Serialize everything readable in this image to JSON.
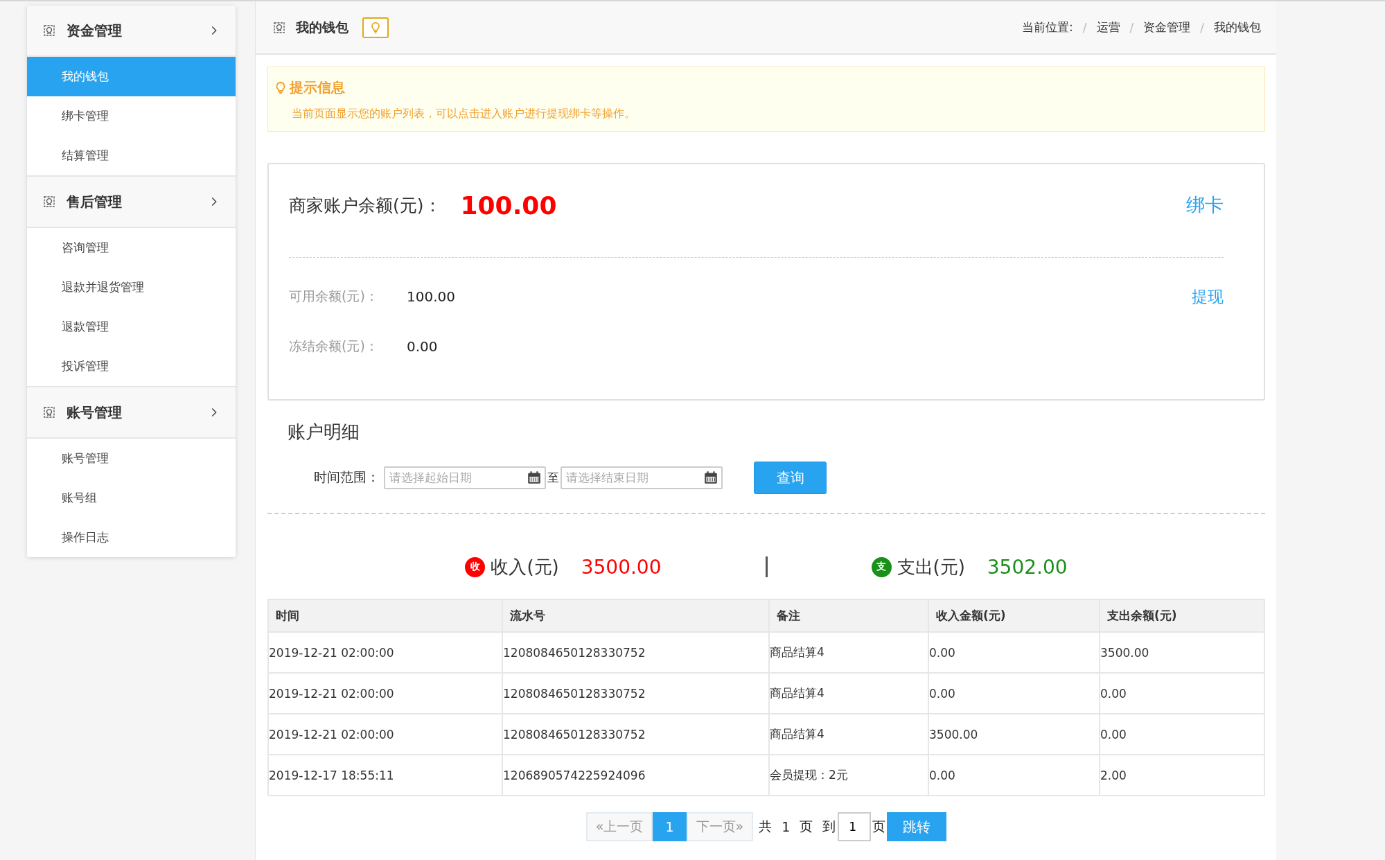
{
  "sidebar": {
    "groups": [
      {
        "title": "资金管理",
        "items": [
          {
            "label": "我的钱包",
            "selected": true
          },
          {
            "label": "绑卡管理",
            "selected": false
          },
          {
            "label": "结算管理",
            "selected": false
          }
        ]
      },
      {
        "title": "售后管理",
        "items": [
          {
            "label": "咨询管理",
            "selected": false
          },
          {
            "label": "退款并退货管理",
            "selected": false
          },
          {
            "label": "退款管理",
            "selected": false
          },
          {
            "label": "投诉管理",
            "selected": false
          }
        ]
      },
      {
        "title": "账号管理",
        "items": [
          {
            "label": "账号管理",
            "selected": false
          },
          {
            "label": "账号组",
            "selected": false
          },
          {
            "label": "操作日志",
            "selected": false
          }
        ]
      }
    ]
  },
  "header": {
    "title": "我的钱包",
    "breadcrumb_label": "当前位置:",
    "separator": "/",
    "breadcrumb": [
      "运营",
      "资金管理",
      "我的钱包"
    ]
  },
  "tip": {
    "title": "提示信息",
    "text": "当前页面显示您的账户列表，可以点击进入账户进行提现绑卡等操作。"
  },
  "balance": {
    "label": "商家账户余额(元)：",
    "amount": "100.00",
    "bind_link": "绑卡",
    "withdraw_link": "提现",
    "rows": [
      {
        "label": "可用余额(元)：",
        "value": "100.00"
      },
      {
        "label": "冻结余额(元)：",
        "value": "0.00"
      }
    ]
  },
  "details": {
    "title": "账户明细",
    "range_label": "时间范围：",
    "start_placeholder": "请选择起始日期",
    "to": "至",
    "end_placeholder": "请选择结束日期",
    "query_button": "查询"
  },
  "summary": [
    {
      "kind": "income",
      "badge": "收",
      "label": "收入(元)",
      "value": "3500.00"
    },
    {
      "kind": "expense",
      "badge": "支",
      "label": "支出(元)",
      "value": "3502.00"
    }
  ],
  "table": {
    "columns": [
      "时间",
      "流水号",
      "备注",
      "收入金额(元)",
      "支出余额(元)"
    ],
    "rows": [
      [
        "2019-12-21 02:00:00",
        "1208084650128330752",
        "商品结算4",
        "0.00",
        "3500.00"
      ],
      [
        "2019-12-21 02:00:00",
        "1208084650128330752",
        "商品结算4",
        "0.00",
        "0.00"
      ],
      [
        "2019-12-21 02:00:00",
        "1208084650128330752",
        "商品结算4",
        "3500.00",
        "0.00"
      ],
      [
        "2019-12-17 18:55:11",
        "1206890574225924096",
        "会员提现：2元",
        "0.00",
        "2.00"
      ]
    ]
  },
  "pagination": {
    "prev": "«上一页",
    "pages": [
      {
        "label": "1",
        "selected": true
      }
    ],
    "next": "下一页»",
    "total_prefix": "共",
    "total": "1",
    "total_suffix": "页",
    "goto_prefix": "到",
    "goto_value": "1",
    "goto_suffix": "页",
    "goto_button": "跳转"
  }
}
